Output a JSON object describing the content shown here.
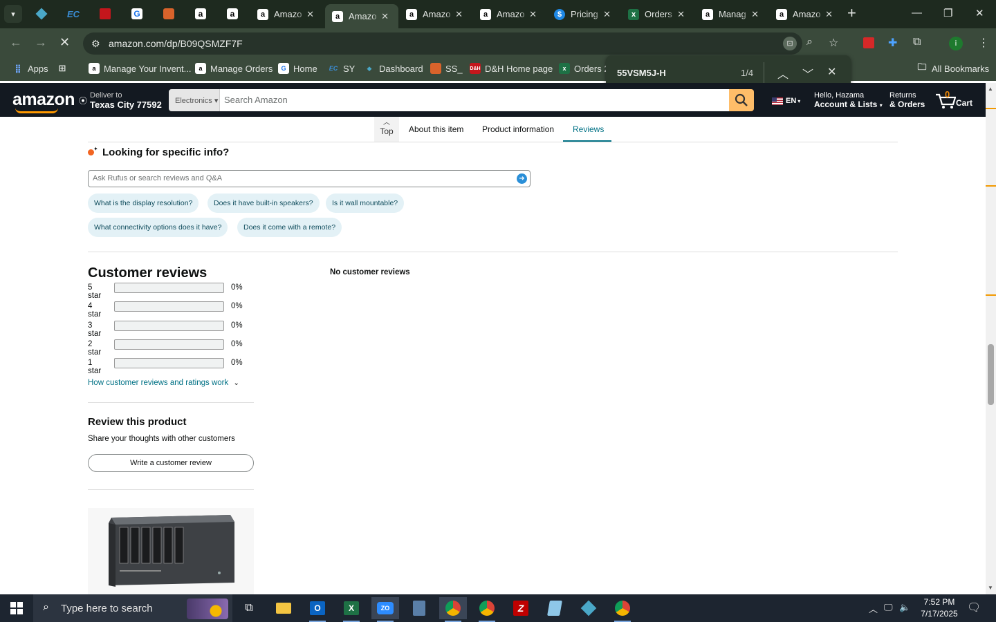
{
  "browser": {
    "tabs": [
      {
        "title": "Amazo",
        "favicon": "A",
        "active": false
      },
      {
        "title": "Amazo",
        "favicon": "A",
        "active": true
      },
      {
        "title": "Amazo",
        "favicon": "A",
        "active": false
      },
      {
        "title": "Amazo",
        "favicon": "A",
        "active": false
      },
      {
        "title": "Pricing",
        "favicon": "$",
        "active": false
      },
      {
        "title": "Orders",
        "favicon": "X",
        "active": false
      },
      {
        "title": "Manag",
        "favicon": "A",
        "active": false
      },
      {
        "title": "Amazo",
        "favicon": "A",
        "active": false
      }
    ],
    "url": "amazon.com/dp/B09QSMZF7F",
    "bookmarks": [
      {
        "label": "Apps"
      },
      {
        "label": ""
      },
      {
        "label": "Manage Your Invent..."
      },
      {
        "label": "Manage Orders"
      },
      {
        "label": "Home"
      },
      {
        "label": "SY"
      },
      {
        "label": "Dashboard"
      },
      {
        "label": "SS_"
      },
      {
        "label": "D&H Home page"
      },
      {
        "label": "Orders 2"
      }
    ],
    "all_bookmarks": "All Bookmarks",
    "find": {
      "query": "55VSM5J-H",
      "count": "1/4"
    }
  },
  "amazon_header": {
    "logo": "amazon",
    "deliver_line1": "Deliver to",
    "deliver_line2": "Texas City 77592",
    "search_category": "Electronics ▾",
    "search_placeholder": "Search Amazon",
    "lang": "EN",
    "account_line1": "Hello, Hazama",
    "account_line2": "Account & Lists",
    "returns_line1": "Returns",
    "returns_line2": "& Orders",
    "cart_count": "0",
    "cart_label": "Cart"
  },
  "subnav": {
    "top": "Top",
    "about": "About this item",
    "product_info": "Product information",
    "reviews": "Reviews"
  },
  "rufus": {
    "title": "Looking for specific info?",
    "placeholder": "Ask Rufus or search reviews and Q&A",
    "chips": [
      "What is the display resolution?",
      "Does it have built-in speakers?",
      "Is it wall mountable?",
      "What connectivity options does it have?",
      "Does it come with a remote?"
    ]
  },
  "reviews": {
    "title": "Customer reviews",
    "rows": [
      {
        "label": "5 star",
        "pct": "0%",
        "fill": 0
      },
      {
        "label": "4 star",
        "pct": "0%",
        "fill": 0
      },
      {
        "label": "3 star",
        "pct": "0%",
        "fill": 0
      },
      {
        "label": "2 star",
        "pct": "0%",
        "fill": 0
      },
      {
        "label": "1 star",
        "pct": "0%",
        "fill": 0
      }
    ],
    "no_reviews": "No customer reviews",
    "how_link": "How customer reviews and ratings work",
    "review_title": "Review this product",
    "review_sub": "Share your thoughts with other customers",
    "write_btn": "Write a customer review"
  },
  "taskbar": {
    "search_placeholder": "Type here to search",
    "time": "7:52 PM",
    "date": "7/17/2025"
  },
  "colors": {
    "amazon_nav": "#131921",
    "amazon_orange": "#ff9900",
    "link_teal": "#007185",
    "chrome_frame": "#1e2a1f"
  }
}
